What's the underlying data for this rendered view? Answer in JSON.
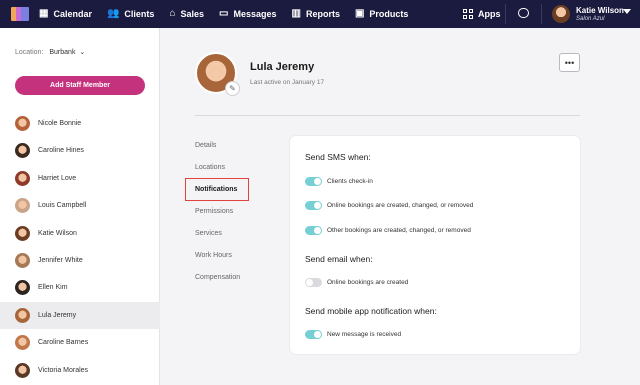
{
  "nav": {
    "items": [
      {
        "label": "Calendar",
        "icon": "calendar-icon",
        "glyph": "▦"
      },
      {
        "label": "Clients",
        "icon": "clients-icon",
        "glyph": "👥"
      },
      {
        "label": "Sales",
        "icon": "tag-icon",
        "glyph": "⌂"
      },
      {
        "label": "Messages",
        "icon": "message-icon",
        "glyph": "▭"
      },
      {
        "label": "Reports",
        "icon": "bar-chart-icon",
        "glyph": "▥"
      },
      {
        "label": "Products",
        "icon": "product-icon",
        "glyph": "▣"
      }
    ],
    "apps_label": "Apps",
    "user_name": "Katie Wilson",
    "user_subtitle": "Salon Azul"
  },
  "sidebar": {
    "location_label": "Location:",
    "location_value": "Burbank",
    "add_button": "Add Staff Member",
    "staff": [
      {
        "name": "Nicole Bonnie",
        "color": "#b5623a"
      },
      {
        "name": "Caroline Hines",
        "color": "#3a2a20"
      },
      {
        "name": "Harriet Love",
        "color": "#8e3b2c"
      },
      {
        "name": "Louis Campbell",
        "color": "#c9a489"
      },
      {
        "name": "Katie Wilson",
        "color": "#6b3e24"
      },
      {
        "name": "Jennifer White",
        "color": "#a57a55"
      },
      {
        "name": "Ellen Kim",
        "color": "#2c2420"
      },
      {
        "name": "Lula Jeremy",
        "color": "#a8653a",
        "active": true
      },
      {
        "name": "Caroline Barnes",
        "color": "#c27748"
      },
      {
        "name": "Victoria Morales",
        "color": "#5a3826"
      }
    ]
  },
  "profile": {
    "name": "Lula Jeremy",
    "last_active": "Last active on January 17",
    "more_label": "•••"
  },
  "subnav": {
    "items": [
      "Details",
      "Locations",
      "Notifications",
      "Permissions",
      "Services",
      "Work Hours",
      "Compensation"
    ],
    "active": "Notifications"
  },
  "notifications": {
    "sms_title": "Send SMS when:",
    "sms_options": [
      {
        "label": "Clients check-in",
        "on": true
      },
      {
        "label": "Online bookings are created, changed, or removed",
        "on": true
      },
      {
        "label": "Other bookings are created, changed, or removed",
        "on": true
      }
    ],
    "email_title": "Send email when:",
    "email_options": [
      {
        "label": "Online bookings are created",
        "on": false
      }
    ],
    "app_title": "Send mobile app notification when:",
    "app_options": [
      {
        "label": "New message is received",
        "on": true
      }
    ]
  }
}
